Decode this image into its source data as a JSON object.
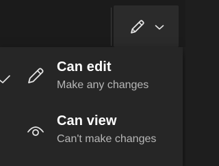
{
  "toolbar": {
    "permission_button": {
      "icon": "pencil-icon",
      "dropdown_icon": "chevron-down-icon"
    }
  },
  "menu": {
    "items": [
      {
        "title": "Can edit",
        "description": "Make any changes",
        "icon": "pencil-icon",
        "selected": true
      },
      {
        "title": "Can view",
        "description": "Can't make changes",
        "icon": "eye-icon",
        "selected": false
      }
    ]
  },
  "colors": {
    "background": "#1b1b1b",
    "menu_background": "#262626",
    "button_background": "#2b2b2b",
    "title_text": "#ffffff",
    "description_text": "#b7b7b7",
    "icon": "#e6e6e6"
  }
}
